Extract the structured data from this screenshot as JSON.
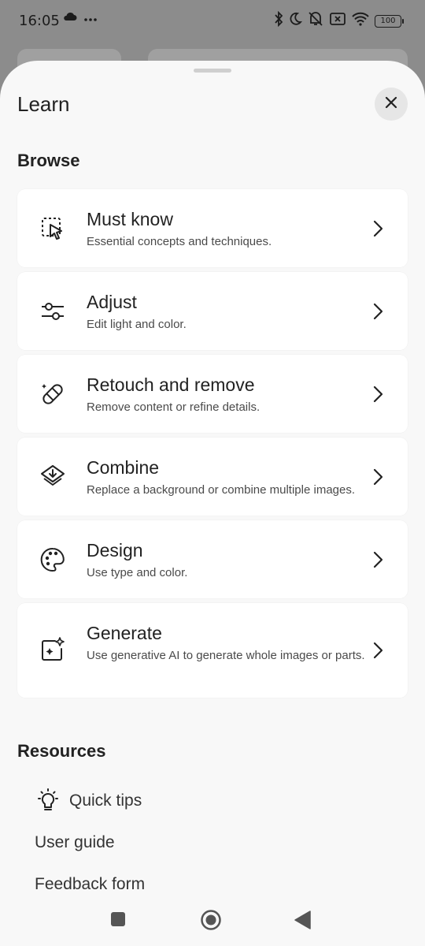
{
  "status_bar": {
    "time": "16:05",
    "battery": "100",
    "left_icons": [
      "cloud-icon",
      "more-dots-icon"
    ],
    "right_icons": [
      "bluetooth-icon",
      "moon-icon",
      "mute-vibrate-icon",
      "sim-x-icon",
      "wifi-icon",
      "battery-icon"
    ]
  },
  "sheet": {
    "title": "Learn",
    "close_icon": "close-icon"
  },
  "browse": {
    "heading": "Browse",
    "items": [
      {
        "title": "Must know",
        "subtitle": "Essential concepts and techniques.",
        "icon": "select-pointer-icon"
      },
      {
        "title": "Adjust",
        "subtitle": "Edit light and color.",
        "icon": "sliders-icon"
      },
      {
        "title": "Retouch and remove",
        "subtitle": "Remove content or refine details.",
        "icon": "bandage-icon"
      },
      {
        "title": "Combine",
        "subtitle": "Replace a background or combine multiple images.",
        "icon": "layers-icon"
      },
      {
        "title": "Design",
        "subtitle": "Use type and color.",
        "icon": "palette-icon"
      },
      {
        "title": "Generate",
        "subtitle": "Use generative AI to generate whole images or parts.",
        "icon": "sparkle-image-icon"
      }
    ]
  },
  "resources": {
    "heading": "Resources",
    "items": [
      {
        "label": "Quick tips",
        "icon": "lightbulb-icon"
      },
      {
        "label": "User guide"
      },
      {
        "label": "Feedback form"
      }
    ]
  },
  "nav_bar": {
    "icons": [
      "recents-square-icon",
      "home-circle-icon",
      "back-triangle-icon"
    ]
  }
}
